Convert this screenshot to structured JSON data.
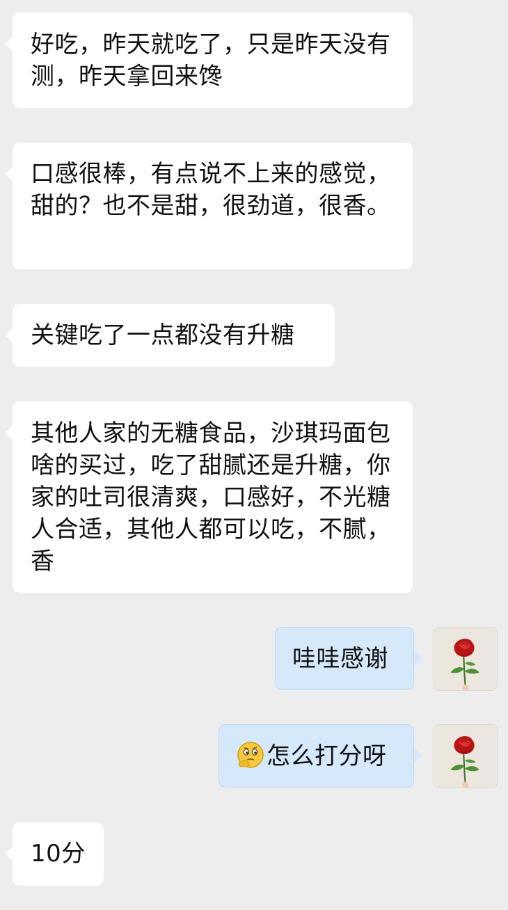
{
  "chat": {
    "messages": [
      {
        "side": "incoming",
        "text": "好吃，昨天就吃了，只是昨天没有测，昨天拿回来馋"
      },
      {
        "side": "incoming",
        "text": "口感很棒，有点说不上来的感觉，甜的？也不是甜，很劲道，很香。"
      },
      {
        "side": "incoming",
        "text": "关键吃了一点都没有升糖"
      },
      {
        "side": "incoming",
        "text": "其他人家的无糖食品，沙琪玛面包啥的买过，吃了甜腻还是升糖，你家的吐司很清爽，口感好，不光糖人合适，其他人都可以吃，不腻，香"
      },
      {
        "side": "outgoing",
        "text": "哇哇感谢",
        "avatar": "rose-avatar"
      },
      {
        "side": "outgoing",
        "emoji": "thinking-face-emoji",
        "text": "怎么打分呀",
        "avatar": "rose-avatar"
      },
      {
        "side": "incoming",
        "text": "10分"
      }
    ]
  },
  "colors": {
    "background": "#ededed",
    "incoming_bubble": "#ffffff",
    "outgoing_bubble": "#d6e9fb",
    "text": "#111111"
  }
}
